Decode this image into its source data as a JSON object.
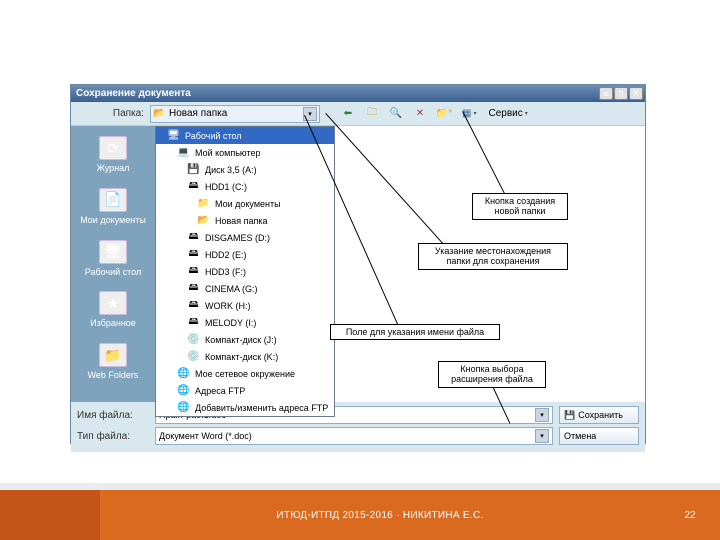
{
  "dialog": {
    "title": "Сохранение документа",
    "folder_label": "Папка:",
    "current_folder": "Новая папка",
    "service_menu": "Сервис",
    "views_menu": "",
    "places": [
      {
        "label": "Журнал",
        "icon": "⟳"
      },
      {
        "label": "Мои документы",
        "icon": "📄"
      },
      {
        "label": "Рабочий стол",
        "icon": "🖥"
      },
      {
        "label": "Избранное",
        "icon": "★"
      },
      {
        "label": "Web Folders",
        "icon": "📁"
      }
    ],
    "dropdown": [
      {
        "label": "Рабочий стол",
        "indent": 0,
        "icon": "🖥",
        "selected": true
      },
      {
        "label": "Мой компьютер",
        "indent": 1,
        "icon": "💻"
      },
      {
        "label": "Диск 3,5 (A:)",
        "indent": 2,
        "icon": "💾"
      },
      {
        "label": "HDD1 (C:)",
        "indent": 2,
        "icon": "🖴"
      },
      {
        "label": "Мои документы",
        "indent": 3,
        "icon": "📁"
      },
      {
        "label": "Новая папка",
        "indent": 3,
        "icon": "📂"
      },
      {
        "label": "DISGAMES (D:)",
        "indent": 2,
        "icon": "🖴"
      },
      {
        "label": "HDD2 (E:)",
        "indent": 2,
        "icon": "🖴"
      },
      {
        "label": "HDD3 (F:)",
        "indent": 2,
        "icon": "🖴"
      },
      {
        "label": "CINEMA (G:)",
        "indent": 2,
        "icon": "🖴"
      },
      {
        "label": "WORK (H:)",
        "indent": 2,
        "icon": "🖴"
      },
      {
        "label": "MELODY (I:)",
        "indent": 2,
        "icon": "🖴"
      },
      {
        "label": "Компакт-диск (J:)",
        "indent": 2,
        "icon": "💿"
      },
      {
        "label": "Компакт-диск (K:)",
        "indent": 2,
        "icon": "💿"
      },
      {
        "label": "Мое сетевое окружение",
        "indent": 1,
        "icon": "🌐"
      },
      {
        "label": "Адреса FTP",
        "indent": 1,
        "icon": "🌐"
      },
      {
        "label": "Добавить/изменить адреса FTP",
        "indent": 1,
        "icon": "🌐"
      }
    ],
    "filename_label": "Имя файла:",
    "filename_value": "Практ раб.1.doc",
    "filetype_label": "Тип файла:",
    "filetype_value": "Документ Word (*.doc)",
    "save_btn": "Сохранить",
    "cancel_btn": "Отмена"
  },
  "callouts": {
    "c1": "Кнопка создания новой папки",
    "c2": "Указание местонахождения папки для сохранения",
    "c3": "Поле для указания имени файла",
    "c4": "Кнопка выбора расширения файла"
  },
  "footer": {
    "text": "ИТЮД-ИТПД 2015-2016 · НИКИТИНА Е.С.",
    "page": "22"
  }
}
